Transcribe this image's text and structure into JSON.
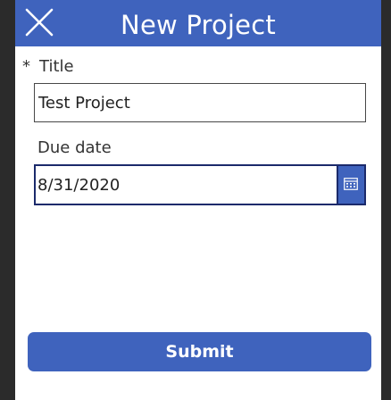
{
  "header": {
    "title": "New Project",
    "close_icon": "close-icon",
    "background_color": "#3f63bd"
  },
  "form": {
    "title_field": {
      "required_marker": "*",
      "label": "Title",
      "value": "Test Project"
    },
    "due_date_field": {
      "label": "Due date",
      "value": "8/31/2020",
      "calendar_icon": "calendar-icon"
    }
  },
  "submit": {
    "label": "Submit"
  }
}
